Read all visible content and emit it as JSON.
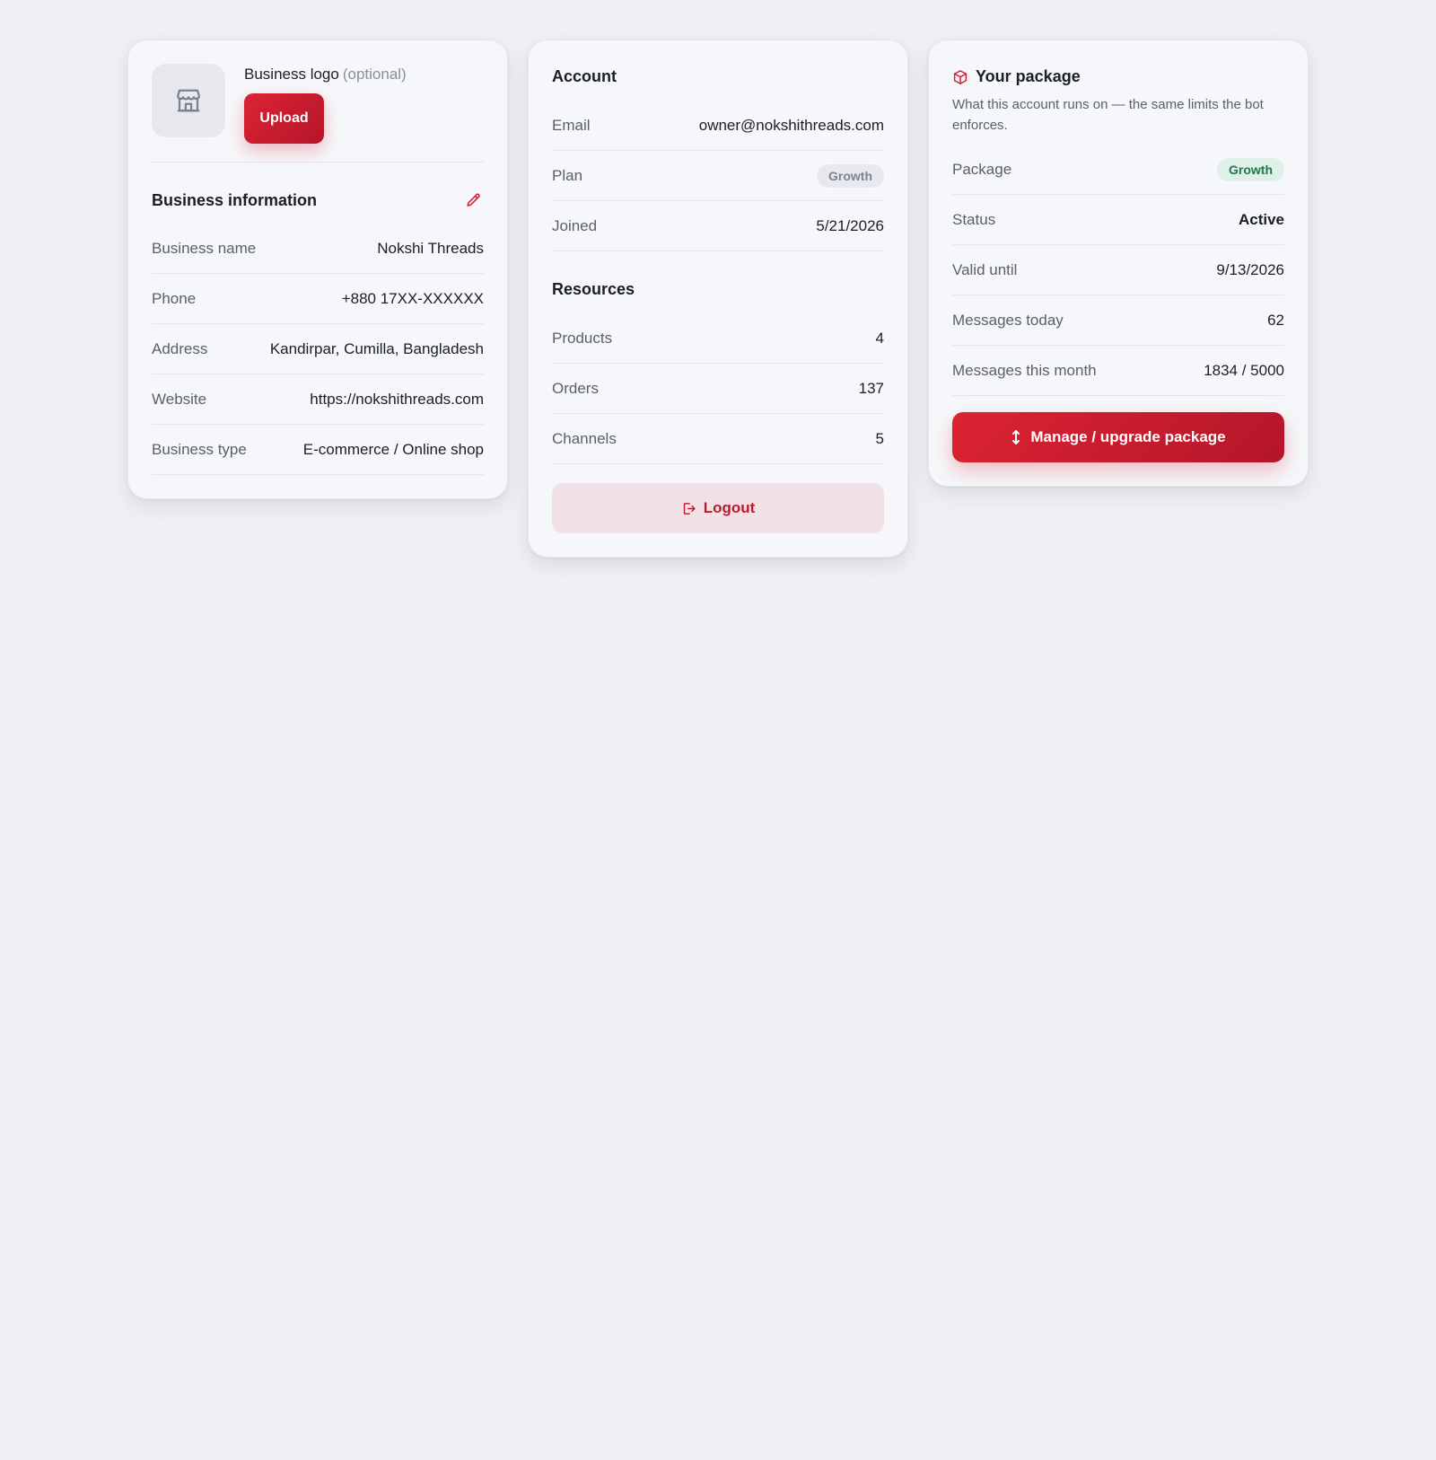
{
  "logo": {
    "label": "Business logo",
    "optional": "(optional)",
    "upload_label": "Upload",
    "icon": "store-icon"
  },
  "business_info": {
    "title": "Business information",
    "edit_icon": "pencil-icon",
    "rows": [
      {
        "label": "Business name",
        "value": "Nokshi Threads"
      },
      {
        "label": "Phone",
        "value": "+880 17XX-XXXXXX"
      },
      {
        "label": "Address",
        "value": "Kandirpar, Cumilla, Bangladesh"
      },
      {
        "label": "Website",
        "value": "https://nokshithreads.com"
      },
      {
        "label": "Business type",
        "value": "E-commerce / Online shop"
      }
    ]
  },
  "account": {
    "title": "Account",
    "email_label": "Email",
    "email_value": "owner@nokshithreads.com",
    "plan_label": "Plan",
    "plan_value": "Growth",
    "joined_label": "Joined",
    "joined_value": "5/21/2026"
  },
  "resources": {
    "title": "Resources",
    "rows": [
      {
        "label": "Products",
        "value": "4"
      },
      {
        "label": "Orders",
        "value": "137"
      },
      {
        "label": "Channels",
        "value": "5"
      }
    ]
  },
  "logout": {
    "label": "Logout",
    "icon": "logout-icon"
  },
  "package": {
    "title": "Your package",
    "icon": "package-icon",
    "description": "What this account runs on — the same limits the bot enforces.",
    "package_label": "Package",
    "package_value": "Growth",
    "status_label": "Status",
    "status_value": "Active",
    "valid_label": "Valid until",
    "valid_value": "9/13/2026",
    "today_label": "Messages today",
    "today_value": "62",
    "month_label": "Messages this month",
    "month_value": "1834 / 5000",
    "manage_label": "Manage / upgrade package",
    "manage_icon": "up-down-arrow-icon"
  },
  "colors": {
    "accent": "#d21f33",
    "success": "#1b8a55",
    "background": "#eff0f4",
    "card": "#f6f7fa"
  }
}
